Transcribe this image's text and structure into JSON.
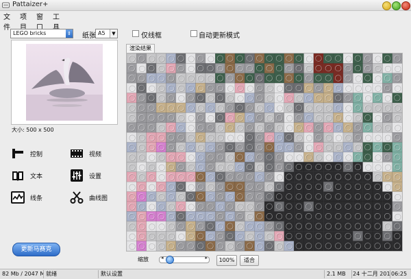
{
  "window": {
    "title": "Pattaizer+"
  },
  "menu": [
    "文件",
    "项目",
    "窗口",
    "工具"
  ],
  "toolbar": {
    "style_select": "LEGO bricks",
    "paper_label": "纸张",
    "paper_select": "A5",
    "outline_only_label": "仅线框",
    "auto_update_label": "自动更新模式"
  },
  "preview": {
    "size_label": "大小: 500 x 500"
  },
  "tools": [
    {
      "label": "控制",
      "icon": "control-icon"
    },
    {
      "label": "视频",
      "icon": "video-icon"
    },
    {
      "label": "文本",
      "icon": "text-icon"
    },
    {
      "label": "设置",
      "icon": "settings-icon"
    },
    {
      "label": "线条",
      "icon": "line-icon"
    },
    {
      "label": "曲线图",
      "icon": "scissors-icon"
    }
  ],
  "update_button": "更新马赛克",
  "render_tab": "渲染结果",
  "zoom": {
    "label": "缩放",
    "level": 0.15,
    "percent_button": "100%",
    "fit_button": "适合"
  },
  "status": {
    "memory": "82 Mb / 2047 Mb",
    "state": "就绪",
    "settings": "默认设置",
    "size": "2.1 MB",
    "date": "24 十二月 2016",
    "time": "06:25"
  },
  "colors": {
    "accent": "#2e6cc8",
    "mosaic_palette": {
      "W": "#e4e4e6",
      "L": "#c6c6c8",
      "G": "#9b9b9f",
      "D": "#6d6e72",
      "K": "#2b2b2d",
      "B": "#a9b2c8",
      "P": "#e3a6b4",
      "M": "#d57fcf",
      "R": "#7a2a22",
      "N": "#8b6a48",
      "E": "#3d5f4b",
      "O": "#7f9a63",
      "T": "#7fb0a4",
      "A": "#c6b08a"
    }
  }
}
